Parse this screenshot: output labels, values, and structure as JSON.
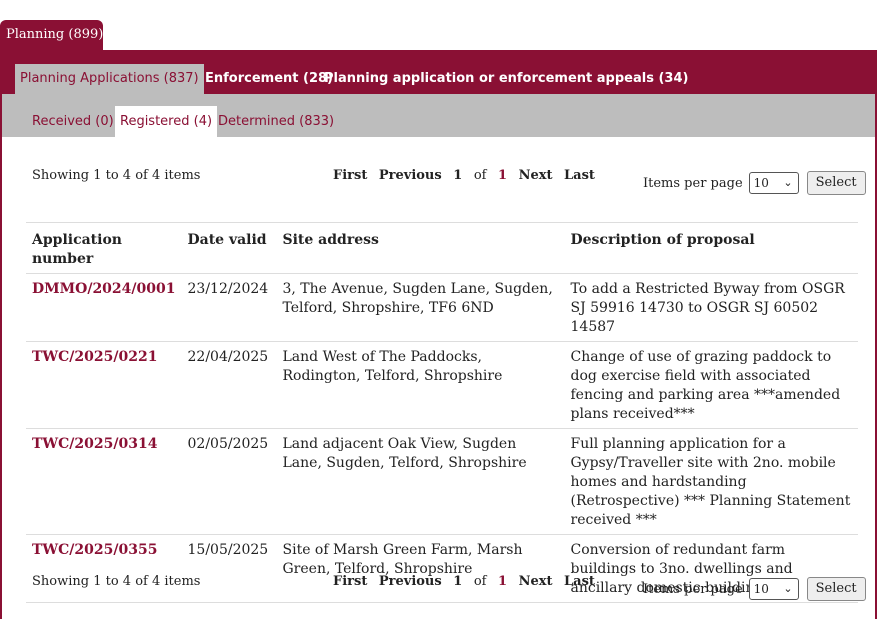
{
  "top_tab": "Planning (899)",
  "second_tabs": [
    "Planning Applications (837)",
    "Enforcement (28)",
    "Planning application or enforcement appeals (34)"
  ],
  "third_tabs": [
    "Received (0)",
    "Registered (4)",
    "Determined (833)"
  ],
  "pager": {
    "showing": "Showing 1 to 4 of 4 items",
    "first": "First",
    "previous": "Previous",
    "page": "1",
    "of": "of",
    "total": "1",
    "next": "Next",
    "last": "Last",
    "ipp_label": "Items per page",
    "ipp_value": "10",
    "select_label": "Select"
  },
  "table": {
    "headers": [
      "Application number",
      "Date valid",
      "Site address",
      "Description of proposal"
    ],
    "rows": [
      {
        "ref": "DMMO/2024/0001",
        "date": "23/12/2024",
        "address": "3, The Avenue, Sugden Lane, Sugden, Telford, Shropshire, TF6 6ND",
        "desc": "To add a Restricted Byway from OSGR SJ 59916 14730 to OSGR SJ 60502 14587"
      },
      {
        "ref": "TWC/2025/0221",
        "date": "22/04/2025",
        "address": "Land West of The Paddocks, Rodington, Telford, Shropshire",
        "desc": "Change of use of grazing paddock to dog exercise field with associated fencing and parking area ***amended plans received***"
      },
      {
        "ref": "TWC/2025/0314",
        "date": "02/05/2025",
        "address": "Land adjacent Oak View, Sugden Lane, Sugden, Telford, Shropshire",
        "desc": "Full planning application for a Gypsy/Traveller site with 2no. mobile homes and hardstanding (Retrospective) *** Planning Statement received ***"
      },
      {
        "ref": "TWC/2025/0355",
        "date": "15/05/2025",
        "address": "Site of Marsh Green Farm, Marsh Green, Telford, Shropshire",
        "desc": "Conversion of redundant farm buildings to 3no. dwellings and ancillary domestic buildings"
      }
    ]
  },
  "colors": {
    "accent": "#8a1034",
    "tab_bar": "#bdbdbd"
  }
}
